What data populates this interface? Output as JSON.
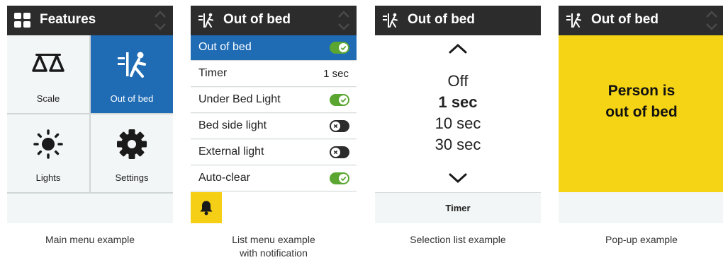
{
  "main_menu": {
    "title": "Features",
    "icon": "features-grid-icon",
    "tiles": [
      {
        "label": "Scale",
        "icon": "scale-icon",
        "selected": false
      },
      {
        "label": "Out of bed",
        "icon": "out-of-bed-icon",
        "selected": true
      },
      {
        "label": "Lights",
        "icon": "sun-icon",
        "selected": false
      },
      {
        "label": "Settings",
        "icon": "gear-icon",
        "selected": false
      }
    ],
    "caption": "Main menu example"
  },
  "list_menu": {
    "title": "Out of bed",
    "icon": "out-of-bed-icon",
    "rows": [
      {
        "label": "Out of bed",
        "toggle": "on",
        "selected": true
      },
      {
        "label": "Timer",
        "value": "1 sec"
      },
      {
        "label": "Under Bed Light",
        "toggle": "on"
      },
      {
        "label": "Bed side light",
        "toggle": "off"
      },
      {
        "label": "External light",
        "toggle": "off"
      },
      {
        "label": "Auto-clear",
        "toggle": "on"
      }
    ],
    "notification_icon": "bell-icon",
    "caption_line1": "List menu example",
    "caption_line2": "with notification"
  },
  "selection_list": {
    "title": "Out of bed",
    "icon": "out-of-bed-icon",
    "options": [
      "Off",
      "1 sec",
      "10 sec",
      "30 sec"
    ],
    "selected_option": "1 sec",
    "footer": "Timer",
    "caption": "Selection list example"
  },
  "popup": {
    "title": "Out of bed",
    "icon": "out-of-bed-icon",
    "message_line1": "Person is",
    "message_line2": "out of bed",
    "caption": "Pop-up example"
  },
  "colors": {
    "header": "#2c2c2c",
    "selected": "#1f6cb5",
    "toggle_on": "#5aa631",
    "popup": "#f5d416",
    "background": "#f3f6f6"
  }
}
